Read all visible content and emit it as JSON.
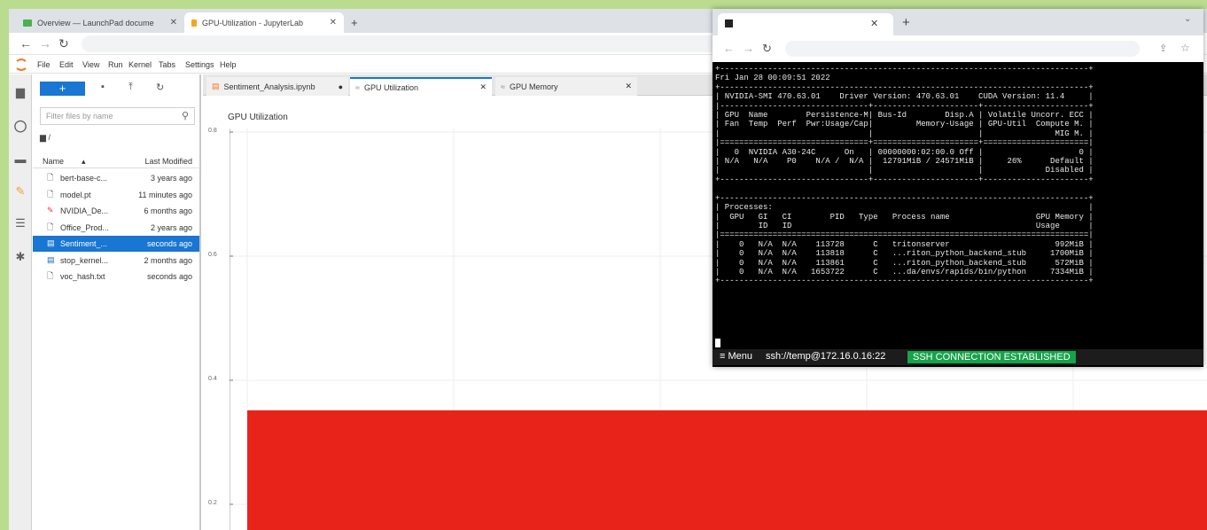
{
  "browser": {
    "tabs": [
      {
        "title": "Overview — LaunchPad docume",
        "icon": "launchpad-icon",
        "color": "#4caf50"
      },
      {
        "title": "GPU-Utilization - JupyterLab",
        "icon": "hourglass-icon",
        "color": "#f5a623"
      }
    ],
    "new_tab": "+"
  },
  "jupyter": {
    "menu": [
      "File",
      "Edit",
      "View",
      "Run",
      "Kernel",
      "Tabs",
      "Settings",
      "Help"
    ],
    "filebrowser": {
      "new_button": "+",
      "filter_placeholder": "Filter files by name",
      "breadcrumb": "/",
      "col_name": "Name",
      "col_modified": "Last Modified",
      "files": [
        {
          "name": "bert-base-c...",
          "modified": "3 years ago",
          "icon": "file-icon"
        },
        {
          "name": "model.pt",
          "modified": "11 minutes ago",
          "icon": "file-icon"
        },
        {
          "name": "NVIDIA_De...",
          "modified": "6 months ago",
          "icon": "pdf-icon"
        },
        {
          "name": "Office_Prod...",
          "modified": "2 years ago",
          "icon": "file-icon"
        },
        {
          "name": "Sentiment_...",
          "modified": "seconds ago",
          "icon": "notebook-icon",
          "selected": true
        },
        {
          "name": "stop_kernel...",
          "modified": "2 months ago",
          "icon": "notebook-icon"
        },
        {
          "name": "voc_hash.txt",
          "modified": "seconds ago",
          "icon": "file-icon"
        }
      ]
    },
    "doc_tabs": [
      {
        "label": "Sentiment_Analysis.ipynb",
        "close": "●"
      },
      {
        "label": "GPU Utilization",
        "close": "✕",
        "active": true
      },
      {
        "label": "GPU Memory",
        "close": "✕"
      }
    ],
    "chart_title": "GPU Utilization"
  },
  "chart_data": {
    "type": "bar",
    "title": "GPU Utilization",
    "yticks": [
      "0.8",
      "0.6",
      "0.4",
      "0.2"
    ],
    "values": [
      0.26
    ],
    "color": "#e8241a"
  },
  "terminal": {
    "lines": [
      "+-----------------------------------------------------------------------------+",
      "Fri Jan 28 00:09:51 2022",
      "+-----------------------------------------------------------------------------+",
      "| NVIDIA-SMI 470.63.01    Driver Version: 470.63.01    CUDA Version: 11.4     |",
      "|-------------------------------+----------------------+----------------------+",
      "| GPU  Name        Persistence-M| Bus-Id        Disp.A | Volatile Uncorr. ECC |",
      "| Fan  Temp  Perf  Pwr:Usage/Cap|         Memory-Usage | GPU-Util  Compute M. |",
      "|                               |                      |               MIG M. |",
      "|===============================+======================+======================|",
      "|   0  NVIDIA A30-24C      On   | 00000000:02:00.0 Off |                    0 |",
      "| N/A   N/A    P0    N/A /  N/A |  12791MiB / 24571MiB |     26%      Default |",
      "|                               |                      |             Disabled |",
      "+-------------------------------+----------------------+----------------------+",
      "",
      "+-----------------------------------------------------------------------------+",
      "| Processes:                                                                  |",
      "|  GPU   GI   CI        PID   Type   Process name                  GPU Memory |",
      "|        ID   ID                                                   Usage      |",
      "|=============================================================================|",
      "|    0   N/A  N/A    113728      C   tritonserver                      992MiB |",
      "|    0   N/A  N/A    113818      C   ...riton_python_backend_stub     1700MiB |",
      "|    0   N/A  N/A    113861      C   ...riton_python_backend_stub      572MiB |",
      "|    0   N/A  N/A   1653722      C   ...da/envs/rapids/bin/python     7334MiB |",
      "+-----------------------------------------------------------------------------+"
    ],
    "status": {
      "menu": "≡ Menu",
      "host": "ssh://temp@172.16.0.16:22",
      "connection": "SSH CONNECTION ESTABLISHED"
    }
  }
}
